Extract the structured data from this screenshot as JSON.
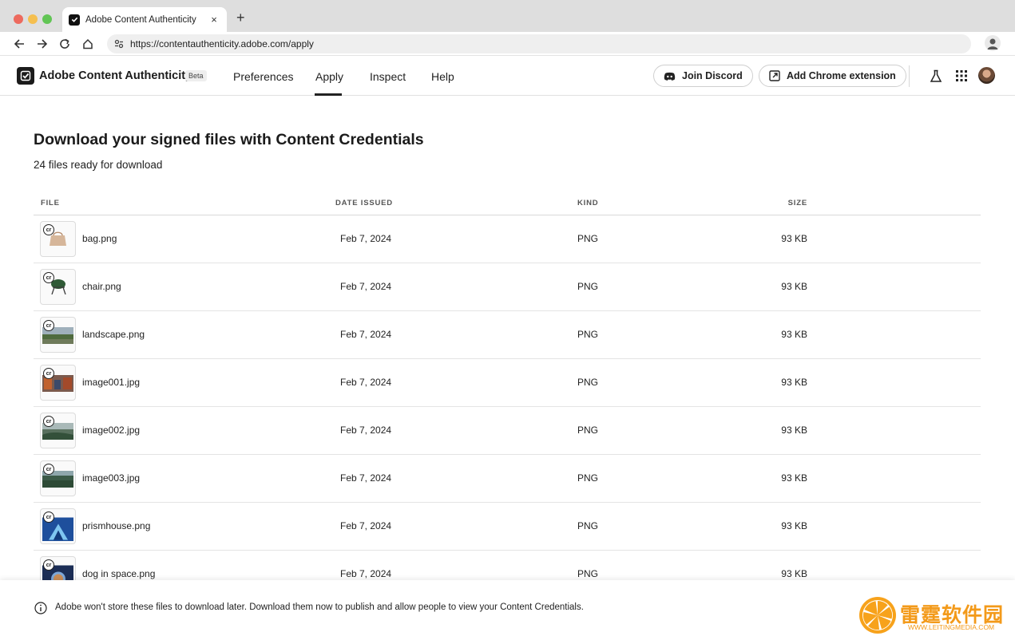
{
  "browser": {
    "tab_title": "Adobe Content Authenticity",
    "close_glyph": "×",
    "newtab_glyph": "+",
    "url": "https://contentauthenticity.adobe.com/apply"
  },
  "header": {
    "brand": "Adobe Content Authenticity",
    "badge": "Beta",
    "nav": [
      {
        "label": "Preferences",
        "active": false
      },
      {
        "label": "Apply",
        "active": true
      },
      {
        "label": "Inspect",
        "active": false
      },
      {
        "label": "Help",
        "active": false
      }
    ],
    "discord_label": "Join Discord",
    "extension_label": "Add Chrome extension"
  },
  "main": {
    "title": "Download your signed files with Content Credentials",
    "subtitle": "24 files ready for download",
    "columns": {
      "file": "FILE",
      "date": "DATE ISSUED",
      "kind": "KIND",
      "size": "SIZE"
    },
    "cr_label": "cr",
    "files": [
      {
        "name": "bag.png",
        "date": "Feb 7, 2024",
        "kind": "PNG",
        "size": "93 KB",
        "thumb": "bag"
      },
      {
        "name": "chair.png",
        "date": "Feb 7, 2024",
        "kind": "PNG",
        "size": "93 KB",
        "thumb": "chair"
      },
      {
        "name": "landscape.png",
        "date": "Feb 7, 2024",
        "kind": "PNG",
        "size": "93 KB",
        "thumb": "landscape"
      },
      {
        "name": "image001.jpg",
        "date": "Feb 7, 2024",
        "kind": "PNG",
        "size": "93 KB",
        "thumb": "image001"
      },
      {
        "name": "image002.jpg",
        "date": "Feb 7, 2024",
        "kind": "PNG",
        "size": "93 KB",
        "thumb": "image002"
      },
      {
        "name": "image003.jpg",
        "date": "Feb 7, 2024",
        "kind": "PNG",
        "size": "93 KB",
        "thumb": "image003"
      },
      {
        "name": "prismhouse.png",
        "date": "Feb 7, 2024",
        "kind": "PNG",
        "size": "93 KB",
        "thumb": "prismhouse"
      },
      {
        "name": "dog in space.png",
        "date": "Feb 7, 2024",
        "kind": "PNG",
        "size": "93 KB",
        "thumb": "dog"
      }
    ]
  },
  "footer": {
    "notice": "Adobe won't store these files to download later. Download them now to publish and allow people to view your Content Credentials."
  },
  "watermark": {
    "text": "雷霆软件园",
    "sub": "WWW.LEITINGMEDIA.COM"
  },
  "colors": {
    "accent": "#222222",
    "watermark": "#f39a1a"
  }
}
